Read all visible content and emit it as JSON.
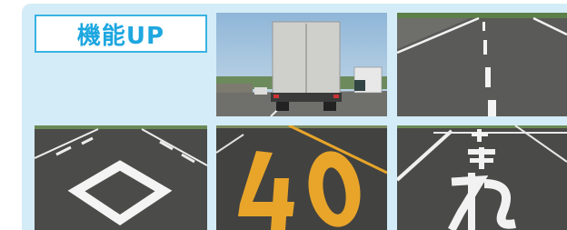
{
  "badge": {
    "label": "機能UP"
  },
  "photos": [
    {
      "name": "truck-rear-view-photo"
    },
    {
      "name": "highway-lane-lines-photo"
    },
    {
      "name": "diamond-road-marking-photo"
    },
    {
      "name": "speed-40-road-marking-photo",
      "marking_text": "40"
    },
    {
      "name": "tomare-stop-road-marking-photo",
      "marking_text": "止まれ"
    }
  ],
  "colors": {
    "panel": "#d4ecf7",
    "badge_text": "#1ea7e0",
    "badge_border": "#39b2e2",
    "yellow_marking": "#e8a52a"
  }
}
